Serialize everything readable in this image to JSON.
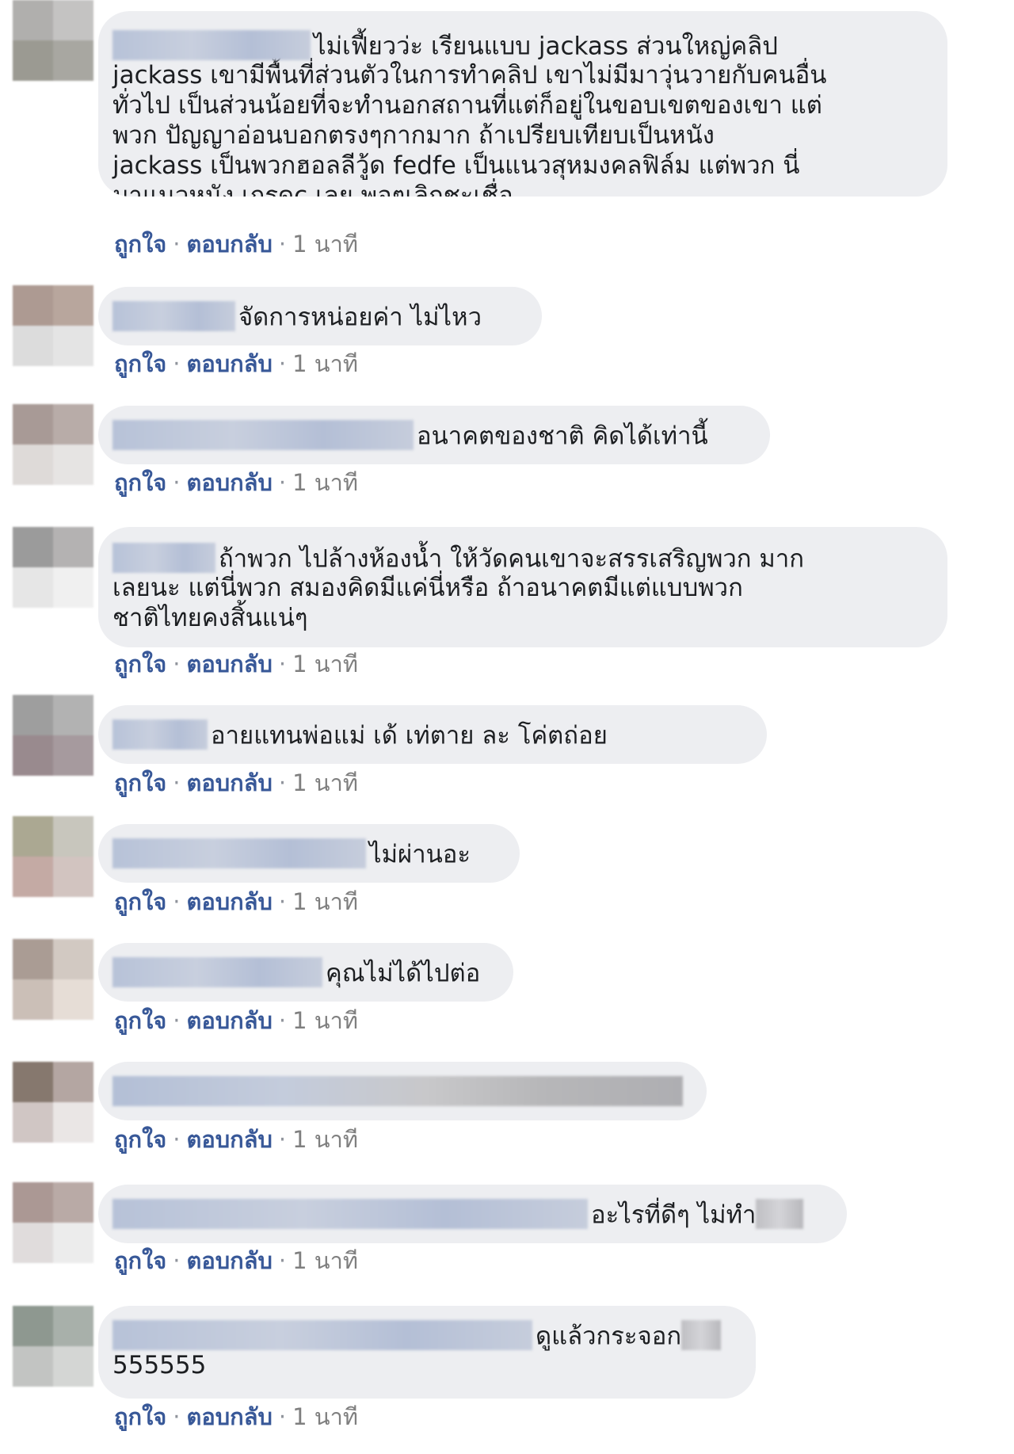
{
  "actions": {
    "like": "ถูกใจ",
    "reply": "ตอบกลับ",
    "separator": "·",
    "time": "1 นาที"
  },
  "colors": {
    "link": "#385898",
    "bubble": "#edeef1",
    "text": "#1c1e21"
  },
  "comments": [
    {
      "lines": [
        "ไม่เฟี้ยวว่ะ เรียนแบบ jackass ส่วนใหญ่คลิป",
        "jackass เขามีพื้นที่ส่วนตัวในการทำคลิป เขาไม่มีมาวุ่นวายกับคนอื่น",
        "ทั่วไป เป็นส่วนน้อยที่จะทำนอกสถานที่แต่ก็อยู่ในขอบเขตของเขา แต่",
        "พวก ปัญญาอ่อนบอกตรงๆกากมาก ถ้าเปรียบเทียบเป็นหนัง",
        "jackass เป็นพวกฮอลลีวู้ด fedfe เป็นแนวสุหมงคลฟิล์ม แต่พวก นี่",
        "มาแนวหนัง เกรดc เลย พอๆเลิกชะเชื่อ"
      ]
    },
    {
      "lines": [
        "จัดการหน่อยค่า ไม่ไหว"
      ]
    },
    {
      "lines": [
        "อนาคตของชาติ คิดได้เท่านี้"
      ]
    },
    {
      "lines": [
        "ถ้าพวก ไปล้างห้องน้ำ ให้วัดคนเขาจะสรรเสริญพวก มาก",
        "เลยนะ แต่นี่พวก สมองคิดมีแค่นี่หรือ ถ้าอนาคตมีแต่แบบพวก",
        "ชาติไทยคงสิ้นแน่ๆ"
      ]
    },
    {
      "lines": [
        "อายแทนพ่อแม่ เด้ เท่ตาย ละ โค่ตถ่อย"
      ]
    },
    {
      "lines": [
        "ไม่ผ่านอะ"
      ]
    },
    {
      "lines": [
        "คุณไม่ได้ไปต่อ"
      ]
    },
    {
      "lines": [
        ""
      ]
    },
    {
      "lines": [
        "อะไรที่ดีๆ ไม่ทำ"
      ]
    },
    {
      "lines": [
        "ดูแล้วกระจอก",
        "555555"
      ]
    }
  ]
}
